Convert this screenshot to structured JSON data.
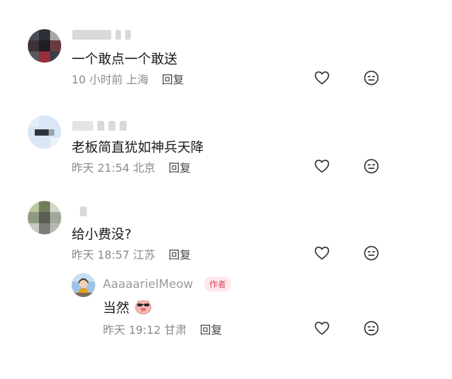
{
  "comments": [
    {
      "text": "一个敢点一个敢送",
      "time": "10 小时前",
      "location": "上海",
      "reply": "回复"
    },
    {
      "text": "老板简直犹如神兵天降",
      "time": "昨天 21:54",
      "location": "北京",
      "reply": "回复"
    },
    {
      "text": "给小费没?",
      "time": "昨天 18:57",
      "location": "江苏",
      "reply": "回复"
    }
  ],
  "author_reply": {
    "name": "AaaaarielMeow",
    "badge": "作者",
    "text": "当然",
    "emoji_icon": "cool-pig-emoji",
    "time": "昨天 19:12",
    "location": "甘肃",
    "reply": "回复"
  },
  "icons": {
    "like": "heart-icon",
    "dislike": "meh-face-icon"
  },
  "colors": {
    "badge_text": "#e0445c",
    "badge_bg": "#fde8ec",
    "meta": "#8a8a8a"
  }
}
